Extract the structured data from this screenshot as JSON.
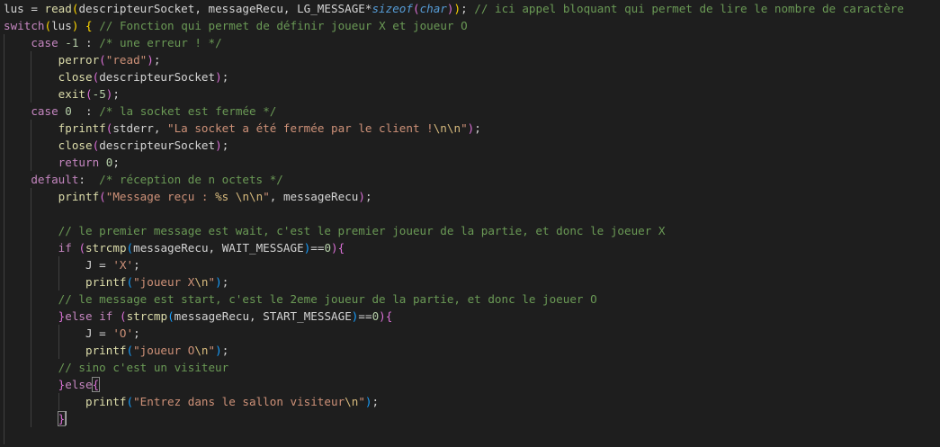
{
  "editor": {
    "lines": [
      {
        "indent": 0,
        "tokens": [
          {
            "t": "lus = ",
            "c": "var"
          },
          {
            "t": "read",
            "c": "fn"
          },
          {
            "t": "(",
            "c": "br3"
          },
          {
            "t": "descripteurSocket, messageRecu, LG_MESSAGE*",
            "c": "var"
          },
          {
            "t": "sizeof",
            "c": "type"
          },
          {
            "t": "(",
            "c": "br1"
          },
          {
            "t": "char",
            "c": "type"
          },
          {
            "t": ")",
            "c": "br1"
          },
          {
            "t": ")",
            "c": "br3"
          },
          {
            "t": "; ",
            "c": "var"
          },
          {
            "t": "// ici appel bloquant qui permet de lire le nombre de caractère",
            "c": "cmt"
          }
        ]
      },
      {
        "indent": 0,
        "tokens": [
          {
            "t": "switch",
            "c": "kw"
          },
          {
            "t": "(",
            "c": "br3"
          },
          {
            "t": "lus",
            "c": "var"
          },
          {
            "t": ")",
            "c": "br3"
          },
          {
            "t": " ",
            "c": "var"
          },
          {
            "t": "{",
            "c": "br3"
          },
          {
            "t": " ",
            "c": "var"
          },
          {
            "t": "// Fonction qui permet de définir joueur X et joueur O",
            "c": "cmt"
          }
        ]
      },
      {
        "indent": 1,
        "tokens": [
          {
            "t": "case",
            "c": "kw"
          },
          {
            "t": " ",
            "c": "var"
          },
          {
            "t": "-1",
            "c": "num"
          },
          {
            "t": " : ",
            "c": "var"
          },
          {
            "t": "/* une erreur ! */",
            "c": "cmt"
          }
        ]
      },
      {
        "indent": 2,
        "tokens": [
          {
            "t": "perror",
            "c": "fn"
          },
          {
            "t": "(",
            "c": "br1"
          },
          {
            "t": "\"read\"",
            "c": "str"
          },
          {
            "t": ")",
            "c": "br1"
          },
          {
            "t": ";",
            "c": "var"
          }
        ]
      },
      {
        "indent": 2,
        "tokens": [
          {
            "t": "close",
            "c": "fn"
          },
          {
            "t": "(",
            "c": "br1"
          },
          {
            "t": "descripteurSocket",
            "c": "var"
          },
          {
            "t": ")",
            "c": "br1"
          },
          {
            "t": ";",
            "c": "var"
          }
        ]
      },
      {
        "indent": 2,
        "tokens": [
          {
            "t": "exit",
            "c": "fn"
          },
          {
            "t": "(",
            "c": "br1"
          },
          {
            "t": "-5",
            "c": "num"
          },
          {
            "t": ")",
            "c": "br1"
          },
          {
            "t": ";",
            "c": "var"
          }
        ]
      },
      {
        "indent": 1,
        "tokens": [
          {
            "t": "case",
            "c": "kw"
          },
          {
            "t": " ",
            "c": "var"
          },
          {
            "t": "0",
            "c": "num"
          },
          {
            "t": "  : ",
            "c": "var"
          },
          {
            "t": "/* la socket est fermée */",
            "c": "cmt"
          }
        ]
      },
      {
        "indent": 2,
        "tokens": [
          {
            "t": "fprintf",
            "c": "fn"
          },
          {
            "t": "(",
            "c": "br1"
          },
          {
            "t": "stderr, ",
            "c": "var"
          },
          {
            "t": "\"La socket a été fermée par le client !",
            "c": "str"
          },
          {
            "t": "\\n\\n",
            "c": "esc"
          },
          {
            "t": "\"",
            "c": "str"
          },
          {
            "t": ")",
            "c": "br1"
          },
          {
            "t": ";",
            "c": "var"
          }
        ]
      },
      {
        "indent": 2,
        "tokens": [
          {
            "t": "close",
            "c": "fn"
          },
          {
            "t": "(",
            "c": "br1"
          },
          {
            "t": "descripteurSocket",
            "c": "var"
          },
          {
            "t": ")",
            "c": "br1"
          },
          {
            "t": ";",
            "c": "var"
          }
        ]
      },
      {
        "indent": 2,
        "tokens": [
          {
            "t": "return",
            "c": "kw"
          },
          {
            "t": " ",
            "c": "var"
          },
          {
            "t": "0",
            "c": "num"
          },
          {
            "t": ";",
            "c": "var"
          }
        ]
      },
      {
        "indent": 1,
        "tokens": [
          {
            "t": "default",
            "c": "kw"
          },
          {
            "t": ":  ",
            "c": "var"
          },
          {
            "t": "/* réception de n octets */",
            "c": "cmt"
          }
        ]
      },
      {
        "indent": 2,
        "tokens": [
          {
            "t": "printf",
            "c": "fn"
          },
          {
            "t": "(",
            "c": "br1"
          },
          {
            "t": "\"Message reçu : ",
            "c": "str"
          },
          {
            "t": "%s",
            "c": "esc"
          },
          {
            "t": " ",
            "c": "str"
          },
          {
            "t": "\\n\\n",
            "c": "esc"
          },
          {
            "t": "\"",
            "c": "str"
          },
          {
            "t": ", messageRecu",
            "c": "var"
          },
          {
            "t": ")",
            "c": "br1"
          },
          {
            "t": ";",
            "c": "var"
          }
        ]
      },
      {
        "indent": 2,
        "tokens": []
      },
      {
        "indent": 2,
        "tokens": [
          {
            "t": "// le premier message est wait, c'est le premier joueur de la partie, et donc le joeuer X",
            "c": "cmt"
          }
        ]
      },
      {
        "indent": 2,
        "tokens": [
          {
            "t": "if",
            "c": "kw"
          },
          {
            "t": " ",
            "c": "var"
          },
          {
            "t": "(",
            "c": "br1"
          },
          {
            "t": "strcmp",
            "c": "fn"
          },
          {
            "t": "(",
            "c": "br2"
          },
          {
            "t": "messageRecu, WAIT_MESSAGE",
            "c": "var"
          },
          {
            "t": ")",
            "c": "br2"
          },
          {
            "t": "==",
            "c": "var"
          },
          {
            "t": "0",
            "c": "num"
          },
          {
            "t": ")",
            "c": "br1"
          },
          {
            "t": "{",
            "c": "br1"
          }
        ]
      },
      {
        "indent": 3,
        "tokens": [
          {
            "t": "J = ",
            "c": "var"
          },
          {
            "t": "'X'",
            "c": "str"
          },
          {
            "t": ";",
            "c": "var"
          }
        ]
      },
      {
        "indent": 3,
        "tokens": [
          {
            "t": "printf",
            "c": "fn"
          },
          {
            "t": "(",
            "c": "br2"
          },
          {
            "t": "\"joueur X",
            "c": "str"
          },
          {
            "t": "\\n",
            "c": "esc"
          },
          {
            "t": "\"",
            "c": "str"
          },
          {
            "t": ")",
            "c": "br2"
          },
          {
            "t": ";",
            "c": "var"
          }
        ]
      },
      {
        "indent": 2,
        "tokens": [
          {
            "t": "// le message est start, c'est le 2eme joueur de la partie, et donc le joeuer O",
            "c": "cmt"
          }
        ]
      },
      {
        "indent": 2,
        "tokens": [
          {
            "t": "}",
            "c": "br1"
          },
          {
            "t": "else",
            "c": "kw"
          },
          {
            "t": " ",
            "c": "var"
          },
          {
            "t": "if",
            "c": "kw"
          },
          {
            "t": " ",
            "c": "var"
          },
          {
            "t": "(",
            "c": "br1"
          },
          {
            "t": "strcmp",
            "c": "fn"
          },
          {
            "t": "(",
            "c": "br2"
          },
          {
            "t": "messageRecu, START_MESSAGE",
            "c": "var"
          },
          {
            "t": ")",
            "c": "br2"
          },
          {
            "t": "==",
            "c": "var"
          },
          {
            "t": "0",
            "c": "num"
          },
          {
            "t": ")",
            "c": "br1"
          },
          {
            "t": "{",
            "c": "br1"
          }
        ]
      },
      {
        "indent": 3,
        "tokens": [
          {
            "t": "J = ",
            "c": "var"
          },
          {
            "t": "'O'",
            "c": "str"
          },
          {
            "t": ";",
            "c": "var"
          }
        ]
      },
      {
        "indent": 3,
        "tokens": [
          {
            "t": "printf",
            "c": "fn"
          },
          {
            "t": "(",
            "c": "br2"
          },
          {
            "t": "\"joueur O",
            "c": "str"
          },
          {
            "t": "\\n",
            "c": "esc"
          },
          {
            "t": "\"",
            "c": "str"
          },
          {
            "t": ")",
            "c": "br2"
          },
          {
            "t": ";",
            "c": "var"
          }
        ]
      },
      {
        "indent": 2,
        "tokens": [
          {
            "t": "// sino c'est un visiteur",
            "c": "cmt"
          }
        ]
      },
      {
        "indent": 2,
        "tokens": [
          {
            "t": "}",
            "c": "br1"
          },
          {
            "t": "else",
            "c": "kw"
          },
          {
            "t": "{",
            "c": "br1 bm"
          }
        ]
      },
      {
        "indent": 3,
        "tokens": [
          {
            "t": "printf",
            "c": "fn"
          },
          {
            "t": "(",
            "c": "br2"
          },
          {
            "t": "\"Entrez dans le sallon visiteur",
            "c": "str"
          },
          {
            "t": "\\n",
            "c": "esc"
          },
          {
            "t": "\"",
            "c": "str"
          },
          {
            "t": ")",
            "c": "br2"
          },
          {
            "t": ";",
            "c": "var"
          }
        ]
      },
      {
        "indent": 2,
        "cursor": true,
        "tokens": [
          {
            "t": "}",
            "c": "br1 bm"
          }
        ]
      },
      {
        "indent": 1,
        "tokens": []
      },
      {
        "indent": 0,
        "tokens": [
          {
            "t": "}",
            "c": "br3"
          }
        ]
      }
    ],
    "colors": {
      "background": "#1e1e1e",
      "keyword": "#c586c0",
      "function": "#dcdcaa",
      "string": "#ce9178",
      "number": "#b5cea8",
      "comment": "#6a9955",
      "type": "#569cd6",
      "escape": "#d7ba7d",
      "bracket_level1": "#da70d6",
      "bracket_level2": "#179fff",
      "bracket_level3": "#ffd700"
    }
  }
}
